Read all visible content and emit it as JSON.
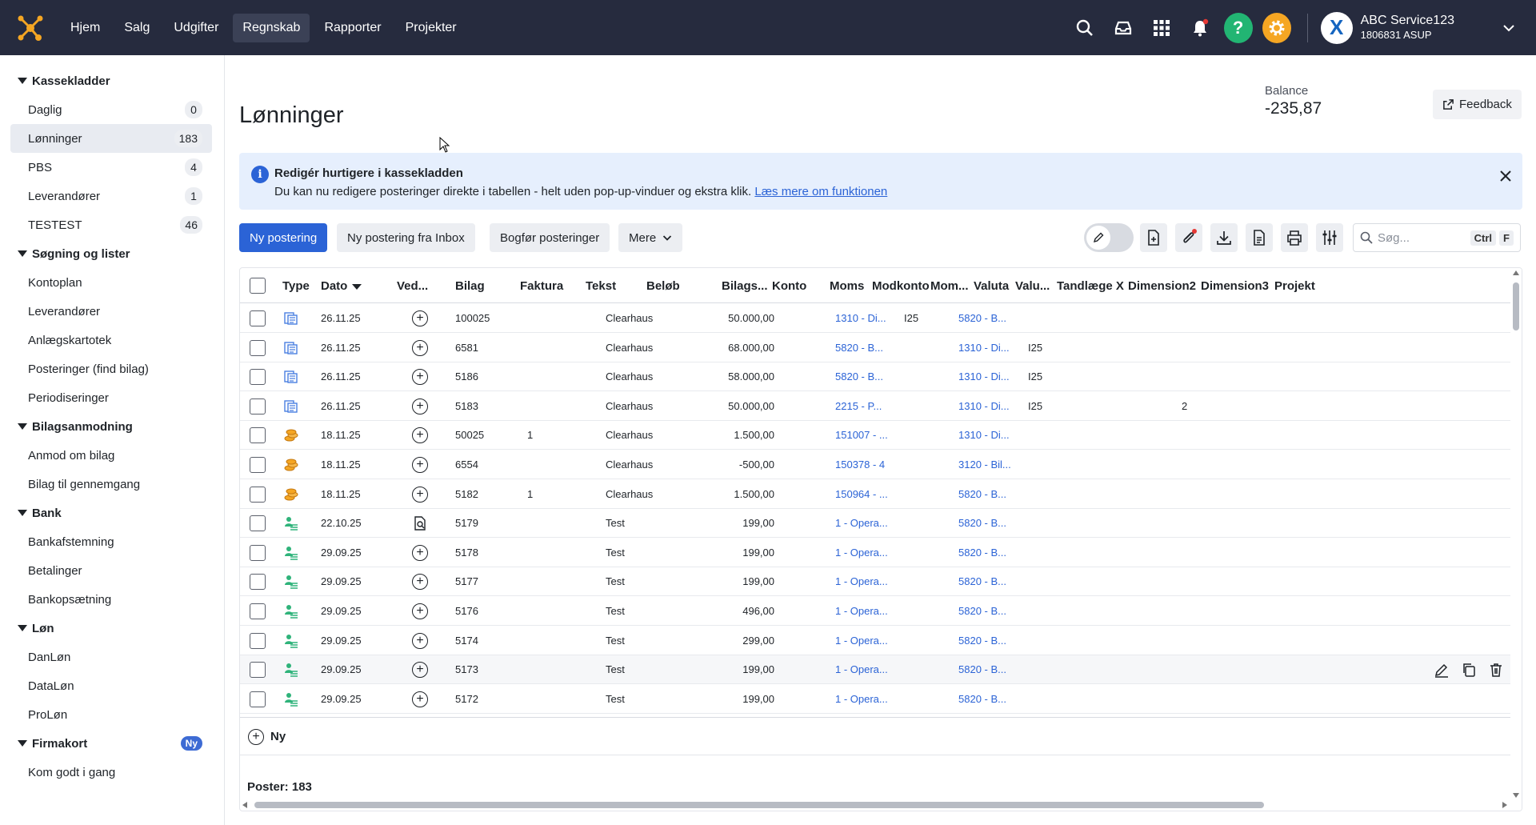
{
  "nav": {
    "items": [
      "Hjem",
      "Salg",
      "Udgifter",
      "Regnskab",
      "Rapporter",
      "Projekter"
    ],
    "active": "Regnskab"
  },
  "account": {
    "name": "ABC Service123",
    "id": "1806831 ASUP",
    "avatar_letter": "X"
  },
  "help_glyph": "?",
  "sidebar": {
    "sections": [
      {
        "title": "Kassekladder",
        "items": [
          {
            "label": "Daglig",
            "count": "0"
          },
          {
            "label": "Lønninger",
            "count": "183",
            "active": true
          },
          {
            "label": "PBS",
            "count": "4"
          },
          {
            "label": "Leverandører",
            "count": "1"
          },
          {
            "label": "TESTEST",
            "count": "46"
          }
        ]
      },
      {
        "title": "Søgning og lister",
        "items": [
          {
            "label": "Kontoplan"
          },
          {
            "label": "Leverandører"
          },
          {
            "label": "Anlægskartotek"
          },
          {
            "label": "Posteringer (find bilag)"
          },
          {
            "label": "Periodiseringer"
          }
        ]
      },
      {
        "title": "Bilagsanmodning",
        "items": [
          {
            "label": "Anmod om bilag"
          },
          {
            "label": "Bilag til gennemgang"
          }
        ]
      },
      {
        "title": "Bank",
        "items": [
          {
            "label": "Bankafstemning"
          },
          {
            "label": "Betalinger"
          },
          {
            "label": "Bankopsætning"
          }
        ]
      },
      {
        "title": "Løn",
        "items": [
          {
            "label": "DanLøn"
          },
          {
            "label": "DataLøn"
          },
          {
            "label": "ProLøn"
          }
        ]
      },
      {
        "title": "Firmakort",
        "badge": "Ny",
        "items": [
          {
            "label": "Kom godt i gang"
          }
        ]
      }
    ]
  },
  "page": {
    "title": "Lønninger",
    "balance_label": "Balance",
    "balance_value": "-235,87",
    "feedback_label": "Feedback"
  },
  "banner": {
    "title": "Redigér hurtigere i kassekladden",
    "text": "Du kan nu redigere posteringer direkte i tabellen - helt uden pop-up-vinduer og ekstra klik.",
    "link": "Læs mere om funktionen"
  },
  "toolbar": {
    "new_entry": "Ny postering",
    "new_from_inbox": "Ny postering fra Inbox",
    "post_entries": "Bogfør posteringer",
    "more": "Mere",
    "search_placeholder": "Søg...",
    "shortcut_keys": [
      "Ctrl",
      "F"
    ]
  },
  "table": {
    "columns": [
      "Type",
      "Dato",
      "Ved...",
      "Bilag",
      "Faktura",
      "Tekst",
      "Beløb",
      "Bilags...",
      "Konto",
      "Moms",
      "Modkonto",
      "Mom...",
      "Valuta",
      "Valu...",
      "Tandlæge X",
      "Dimension2",
      "Dimension3",
      "Projekt"
    ],
    "sort_column": "Dato",
    "rows": [
      {
        "type": "document",
        "date": "26.11.25",
        "attach": "plus",
        "bilag": "100025",
        "faktura": "",
        "text": "Clearhaus",
        "amount": "50.000,00",
        "konto": "1310 - Di...",
        "moms": "I25",
        "modkonto": "5820 - B...",
        "modmoms": "",
        "tandlaege": ""
      },
      {
        "type": "document",
        "date": "26.11.25",
        "attach": "plus",
        "bilag": "6581",
        "faktura": "",
        "text": "Clearhaus",
        "amount": "68.000,00",
        "konto": "5820 - B...",
        "moms": "",
        "modkonto": "1310 - Di...",
        "modmoms": "I25",
        "tandlaege": ""
      },
      {
        "type": "document",
        "date": "26.11.25",
        "attach": "plus",
        "bilag": "5186",
        "faktura": "",
        "text": "Clearhaus",
        "amount": "58.000,00",
        "konto": "5820 - B...",
        "moms": "",
        "modkonto": "1310 - Di...",
        "modmoms": "I25",
        "tandlaege": ""
      },
      {
        "type": "document",
        "date": "26.11.25",
        "attach": "plus",
        "bilag": "5183",
        "faktura": "",
        "text": "Clearhaus",
        "amount": "50.000,00",
        "konto": "2215 - P...",
        "moms": "",
        "modkonto": "1310 - Di...",
        "modmoms": "I25",
        "tandlaege": "2"
      },
      {
        "type": "coins",
        "date": "18.11.25",
        "attach": "plus",
        "bilag": "50025",
        "faktura": "1",
        "text": "Clearhaus",
        "amount": "1.500,00",
        "konto": "151007 - ...",
        "moms": "",
        "modkonto": "1310 - Di...",
        "modmoms": "",
        "tandlaege": ""
      },
      {
        "type": "coins",
        "date": "18.11.25",
        "attach": "plus",
        "bilag": "6554",
        "faktura": "",
        "text": "Clearhaus",
        "amount": "-500,00",
        "konto": "150378 - 4",
        "moms": "",
        "modkonto": "3120 - Bil...",
        "modmoms": "",
        "tandlaege": ""
      },
      {
        "type": "coins",
        "date": "18.11.25",
        "attach": "plus",
        "bilag": "5182",
        "faktura": "1",
        "text": "Clearhaus",
        "amount": "1.500,00",
        "konto": "150964 - ...",
        "moms": "",
        "modkonto": "5820 - B...",
        "modmoms": "",
        "tandlaege": ""
      },
      {
        "type": "salary",
        "date": "22.10.25",
        "attach": "doc-search",
        "bilag": "5179",
        "faktura": "",
        "text": "Test",
        "amount": "199,00",
        "konto": "1 - Opera...",
        "moms": "",
        "modkonto": "5820 - B...",
        "modmoms": "",
        "tandlaege": ""
      },
      {
        "type": "salary",
        "date": "29.09.25",
        "attach": "plus",
        "bilag": "5178",
        "faktura": "",
        "text": "Test",
        "amount": "199,00",
        "konto": "1 - Opera...",
        "moms": "",
        "modkonto": "5820 - B...",
        "modmoms": "",
        "tandlaege": ""
      },
      {
        "type": "salary",
        "date": "29.09.25",
        "attach": "plus",
        "bilag": "5177",
        "faktura": "",
        "text": "Test",
        "amount": "199,00",
        "konto": "1 - Opera...",
        "moms": "",
        "modkonto": "5820 - B...",
        "modmoms": "",
        "tandlaege": ""
      },
      {
        "type": "salary",
        "date": "29.09.25",
        "attach": "plus",
        "bilag": "5176",
        "faktura": "",
        "text": "Test",
        "amount": "496,00",
        "konto": "1 - Opera...",
        "moms": "",
        "modkonto": "5820 - B...",
        "modmoms": "",
        "tandlaege": ""
      },
      {
        "type": "salary",
        "date": "29.09.25",
        "attach": "plus",
        "bilag": "5174",
        "faktura": "",
        "text": "Test",
        "amount": "299,00",
        "konto": "1 - Opera...",
        "moms": "",
        "modkonto": "5820 - B...",
        "modmoms": "",
        "tandlaege": ""
      },
      {
        "type": "salary",
        "date": "29.09.25",
        "attach": "plus",
        "bilag": "5173",
        "faktura": "",
        "text": "Test",
        "amount": "199,00",
        "konto": "1 - Opera...",
        "moms": "",
        "modkonto": "5820 - B...",
        "modmoms": "",
        "tandlaege": "",
        "hover": true
      },
      {
        "type": "salary",
        "date": "29.09.25",
        "attach": "plus",
        "bilag": "5172",
        "faktura": "",
        "text": "Test",
        "amount": "199,00",
        "konto": "1 - Opera...",
        "moms": "",
        "modkonto": "5820 - B...",
        "modmoms": "",
        "tandlaege": ""
      }
    ],
    "new_row_label": "Ny",
    "footer": "Poster: 183"
  },
  "colors": {
    "topbar": "#262b3e",
    "primary": "#2b63d6",
    "help": "#22b573",
    "settings": "#f5a623",
    "link": "#2b63d6"
  }
}
